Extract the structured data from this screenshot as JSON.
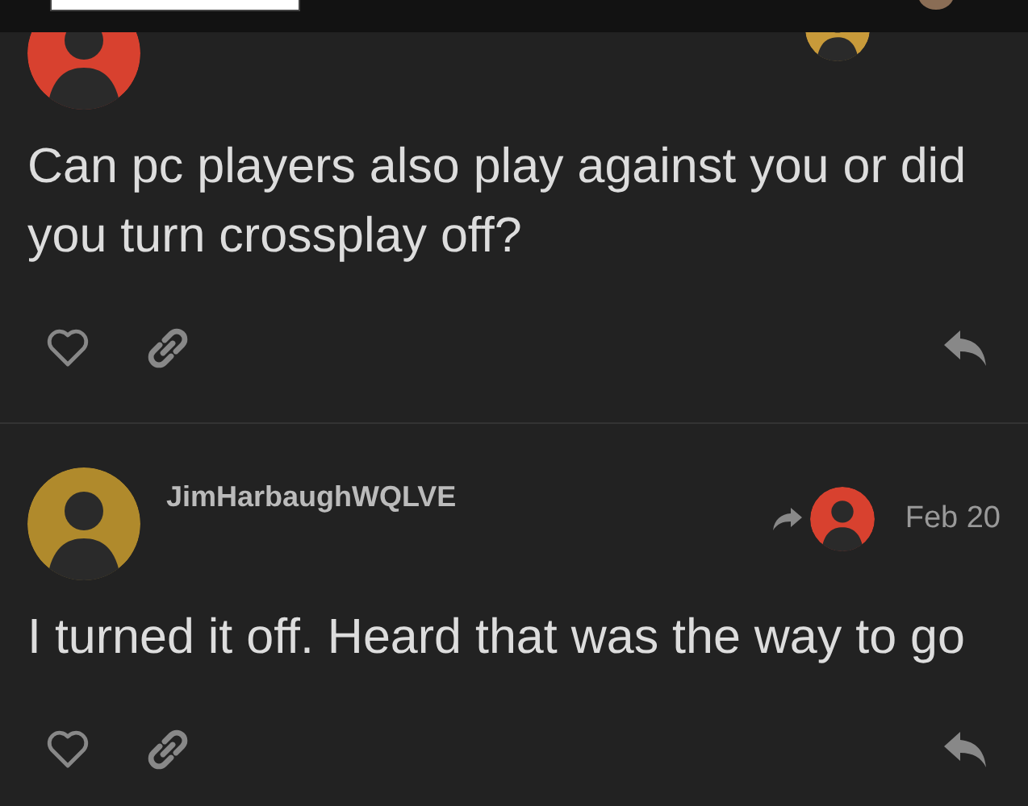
{
  "posts": [
    {
      "avatar": {
        "color": "#d8412f"
      },
      "reply_to_avatar": {
        "color": "#c89a3a"
      },
      "body": "Can pc players also play against you or did you turn crossplay off?"
    },
    {
      "avatar": {
        "color": "#b08a2c"
      },
      "username": "JimHarbaughWQLVE",
      "reply_to_avatar": {
        "color": "#d8412f"
      },
      "date": "Feb 20",
      "body": "I turned it off. Heard that was the way to go"
    }
  ]
}
